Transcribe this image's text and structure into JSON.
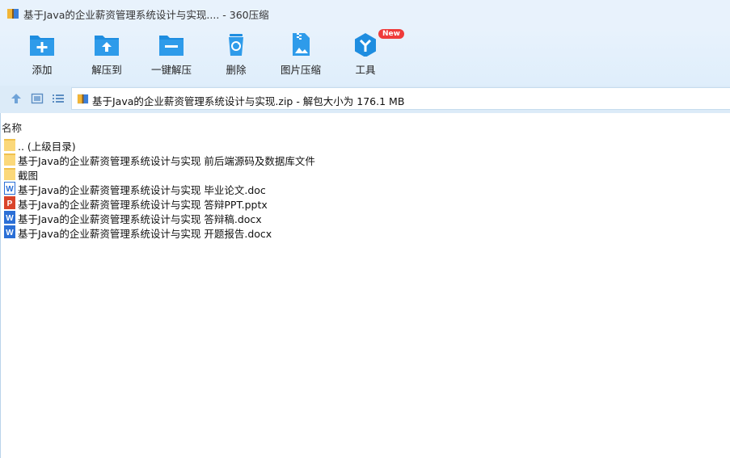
{
  "window": {
    "title": "基于Java的企业薪资管理系统设计与实现.... - 360压缩"
  },
  "toolbar": {
    "add": "添加",
    "extract_to": "解压到",
    "one_click_extract": "一键解压",
    "delete": "删除",
    "image_compress": "图片压缩",
    "tools": "工具",
    "new_badge": "New"
  },
  "address": {
    "text": "基于Java的企业薪资管理系统设计与实现.zip - 解包大小为 176.1 MB"
  },
  "list": {
    "column_name": "名称",
    "items": [
      {
        "name": ".. (上级目录)",
        "icon": "folder-icon"
      },
      {
        "name": "基于Java的企业薪资管理系统设计与实现 前后端源码及数据库文件",
        "icon": "folder-icon"
      },
      {
        "name": "截图",
        "icon": "folder-icon"
      },
      {
        "name": "基于Java的企业薪资管理系统设计与实现 毕业论文.doc",
        "icon": "word-doc-icon"
      },
      {
        "name": "基于Java的企业薪资管理系统设计与实现 答辩PPT.pptx",
        "icon": "powerpoint-icon"
      },
      {
        "name": "基于Java的企业薪资管理系统设计与实现 答辩稿.docx",
        "icon": "word-docx-icon"
      },
      {
        "name": "基于Java的企业薪资管理系统设计与实现 开题报告.docx",
        "icon": "word-docx-icon"
      }
    ]
  },
  "colors": {
    "accent": "#1e8de0",
    "folder": "#fbd87a",
    "word": "#2b6fd6",
    "powerpoint": "#d9442a",
    "badge": "#ef3b3b"
  }
}
